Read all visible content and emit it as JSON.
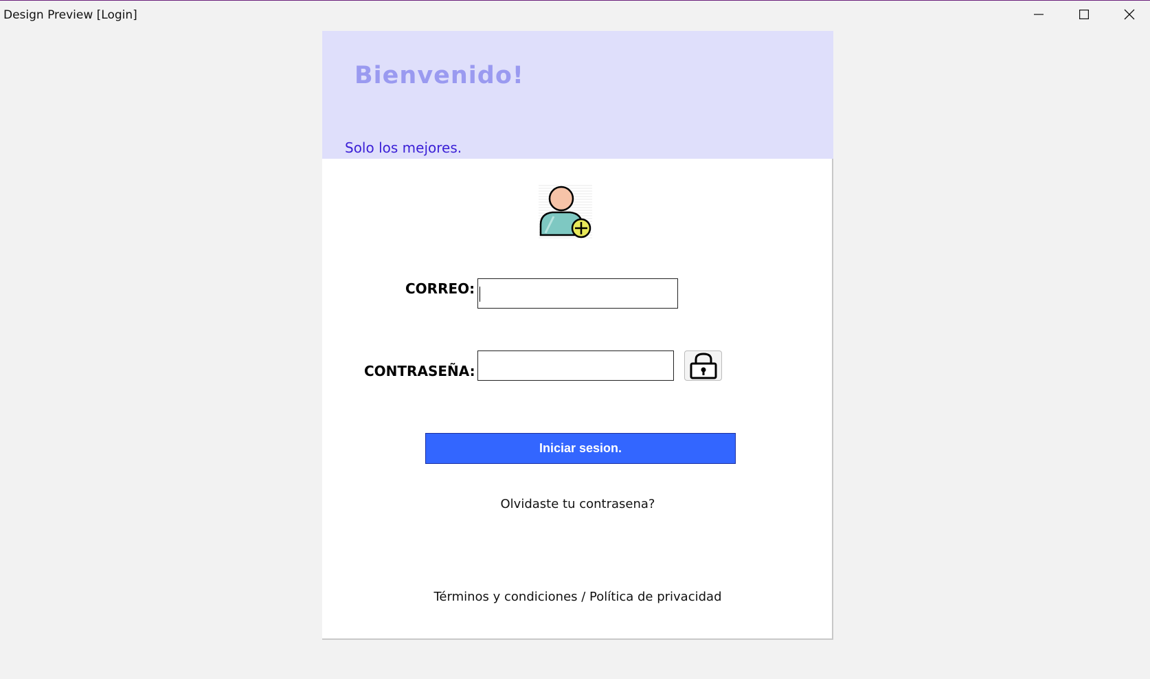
{
  "window": {
    "title": "Design Preview [Login]",
    "controls": {
      "minimize": "minimize-icon",
      "maximize": "maximize-icon",
      "close": "close-icon"
    }
  },
  "header": {
    "welcome": "Bienvenido!",
    "tagline": "Solo los mejores.",
    "background": "#dfdffb",
    "welcome_color": "#9a9af0",
    "tagline_color": "#3a1fd6"
  },
  "avatar": {
    "icon": "add-user-icon"
  },
  "form": {
    "email_label": "CORREO:",
    "email_value": "",
    "password_label": "CONTRASEÑA:",
    "password_value": "",
    "lock_icon": "lock-icon",
    "submit_label": "Iniciar sesion.",
    "submit_color": "#3366ff"
  },
  "links": {
    "forgot": "Olvidaste tu contrasena?",
    "terms": "Términos y condiciones / Política de privacidad"
  }
}
